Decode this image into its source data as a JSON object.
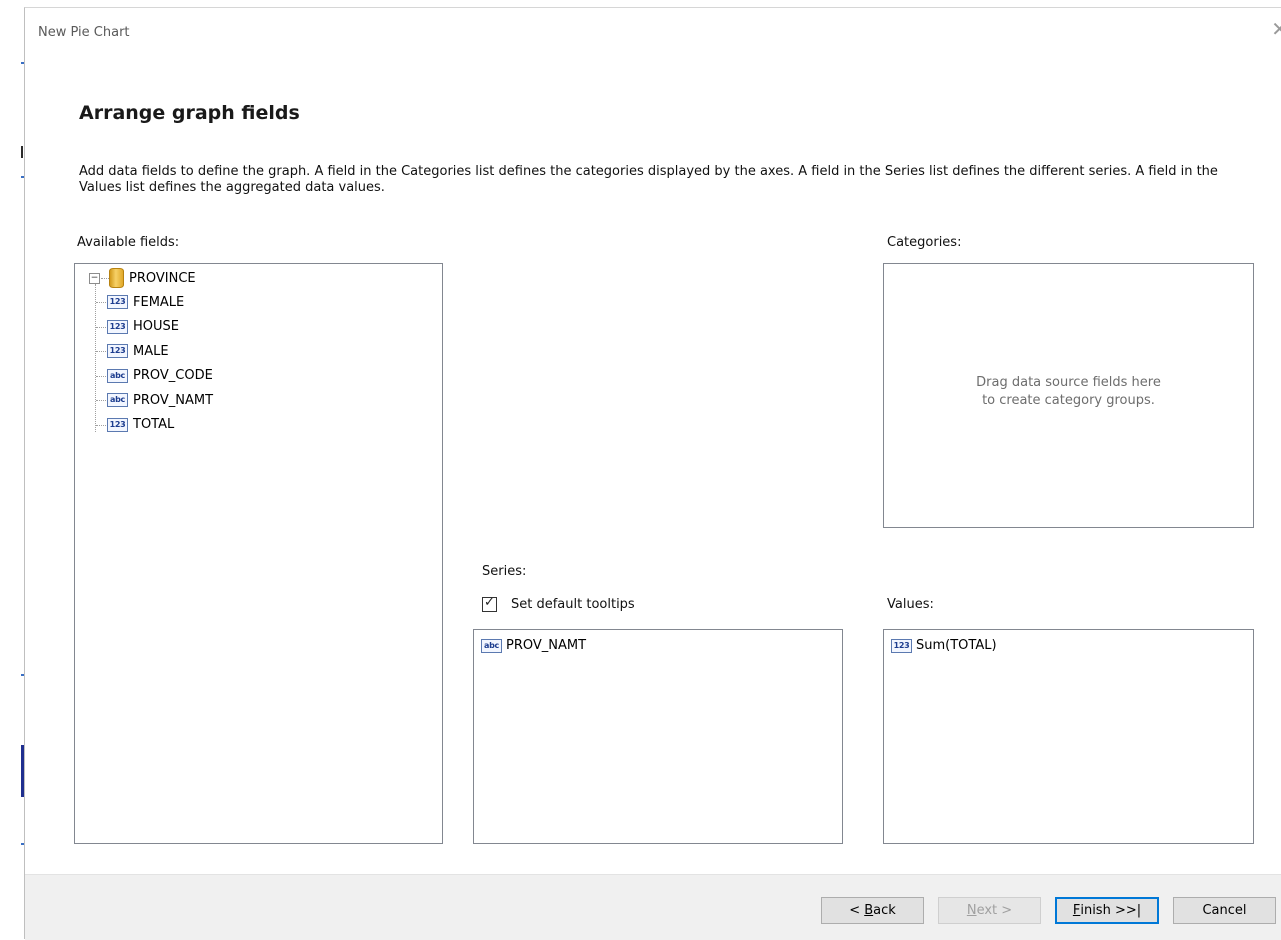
{
  "window": {
    "title": "New Pie Chart"
  },
  "page": {
    "heading": "Arrange graph fields",
    "description": "Add data fields to define the graph. A field in the Categories list defines the categories displayed by the axes. A field in the Series list defines the different series. A field in the Values list defines the aggregated data values."
  },
  "available_fields": {
    "label": "Available fields:",
    "root": {
      "name": "PROVINCE",
      "expander": "−",
      "icon": "database-icon"
    },
    "fields": [
      {
        "name": "FEMALE",
        "type": "123"
      },
      {
        "name": "HOUSE",
        "type": "123"
      },
      {
        "name": "MALE",
        "type": "123"
      },
      {
        "name": "PROV_CODE",
        "type": "abc"
      },
      {
        "name": "PROV_NAMT",
        "type": "abc"
      },
      {
        "name": "TOTAL",
        "type": "123"
      }
    ]
  },
  "categories": {
    "label": "Categories:",
    "hint_line1": "Drag data source fields here",
    "hint_line2": "to create category groups."
  },
  "series": {
    "label": "Series:",
    "tooltips_label": "Set default tooltips",
    "tooltips_checked": true,
    "items": [
      {
        "name": "PROV_NAMT",
        "type": "abc"
      }
    ]
  },
  "values": {
    "label": "Values:",
    "items": [
      {
        "name": "Sum(TOTAL)",
        "type": "123"
      }
    ]
  },
  "buttons": {
    "back": {
      "mnemonic": "B",
      "rest": "ack",
      "prefix": "< "
    },
    "next": {
      "mnemonic": "N",
      "rest": "ext >"
    },
    "finish": {
      "mnemonic": "F",
      "rest": "inish >>|"
    },
    "cancel": {
      "label": "Cancel"
    }
  }
}
